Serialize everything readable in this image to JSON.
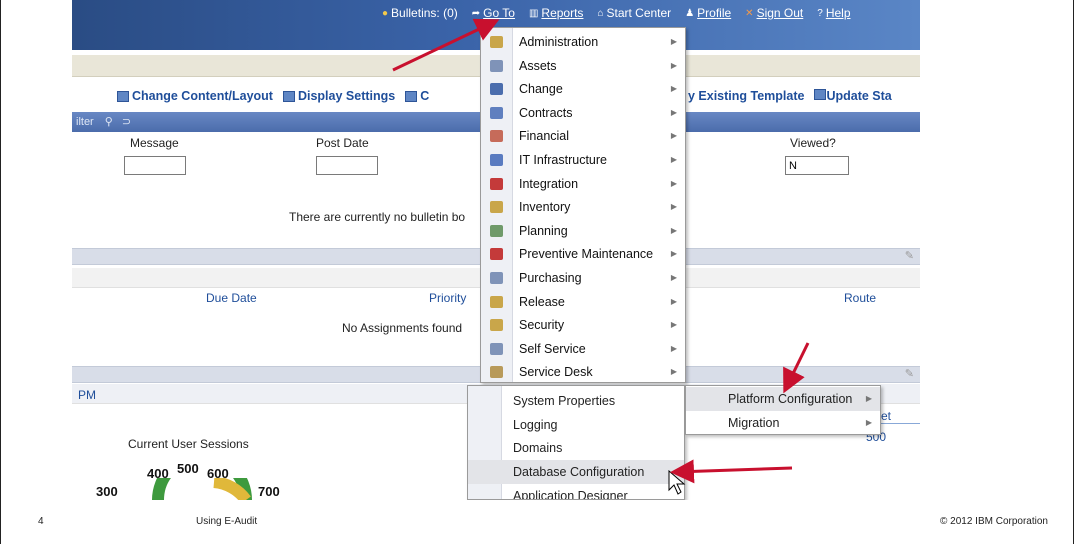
{
  "colors": {
    "accent": "#c8102e",
    "link": "#1f4e9a",
    "topbar": "#3a63a8"
  },
  "topbar": {
    "bulletins": "Bulletins: (0)",
    "goto": "Go To",
    "reports": "Reports",
    "start_center": "Start Center",
    "profile": "Profile",
    "sign_out": "Sign Out",
    "help": "Help"
  },
  "toolbar": {
    "change_layout": "Change Content/Layout",
    "display_settings": "Display Settings",
    "existing_template": "y Existing Template",
    "update": "Update Sta"
  },
  "filterbar": {
    "label": "ilter"
  },
  "bulletin": {
    "columns": [
      "Message",
      "Post Date",
      "Viewed?"
    ],
    "viewed_filter_value": "N",
    "empty_message": "There are currently no bulletin bo"
  },
  "assignments": {
    "columns": [
      "Due Date",
      "Priority",
      "Route"
    ],
    "empty_message": "No Assignments found"
  },
  "portlet3": {
    "left_text": "PM",
    "right_text_1": "et",
    "right_text_2": "500"
  },
  "goto_menu": {
    "items": [
      {
        "label": "Administration",
        "icon": "administration-icon",
        "color": "#c9a64a"
      },
      {
        "label": "Assets",
        "icon": "assets-icon",
        "color": "#7f93b8"
      },
      {
        "label": "Change",
        "icon": "change-icon",
        "color": "#4b6dad"
      },
      {
        "label": "Contracts",
        "icon": "contracts-icon",
        "color": "#5f7fbf"
      },
      {
        "label": "Financial",
        "icon": "financial-icon",
        "color": "#c66b5a"
      },
      {
        "label": "IT Infrastructure",
        "icon": "it-infrastructure-icon",
        "color": "#5a7bc0"
      },
      {
        "label": "Integration",
        "icon": "integration-icon",
        "color": "#c43a3a"
      },
      {
        "label": "Inventory",
        "icon": "inventory-icon",
        "color": "#c9a64a"
      },
      {
        "label": "Planning",
        "icon": "planning-icon",
        "color": "#6f9a6a"
      },
      {
        "label": "Preventive Maintenance",
        "icon": "preventive-maintenance-icon",
        "color": "#c43a3a"
      },
      {
        "label": "Purchasing",
        "icon": "purchasing-icon",
        "color": "#7f93b8"
      },
      {
        "label": "Release",
        "icon": "release-icon",
        "color": "#c9a64a"
      },
      {
        "label": "Security",
        "icon": "security-icon",
        "color": "#c9a64a"
      },
      {
        "label": "Self Service",
        "icon": "self-service-icon",
        "color": "#7f93b8"
      },
      {
        "label": "Service Desk",
        "icon": "service-desk-icon",
        "color": "#b89a5a"
      }
    ]
  },
  "system_config_menu": {
    "items": [
      "System Properties",
      "Logging",
      "Domains",
      "Database Configuration",
      "Application Designer"
    ]
  },
  "platform_menu": {
    "items": [
      "Platform Configuration",
      "Migration"
    ]
  },
  "gauge": {
    "title": "Current User Sessions",
    "labels": [
      "300",
      "400",
      "500",
      "600",
      "700"
    ]
  },
  "footer": {
    "page_number": "4",
    "title": "Using E-Audit",
    "copyright": "© 2012 IBM Corporation"
  }
}
